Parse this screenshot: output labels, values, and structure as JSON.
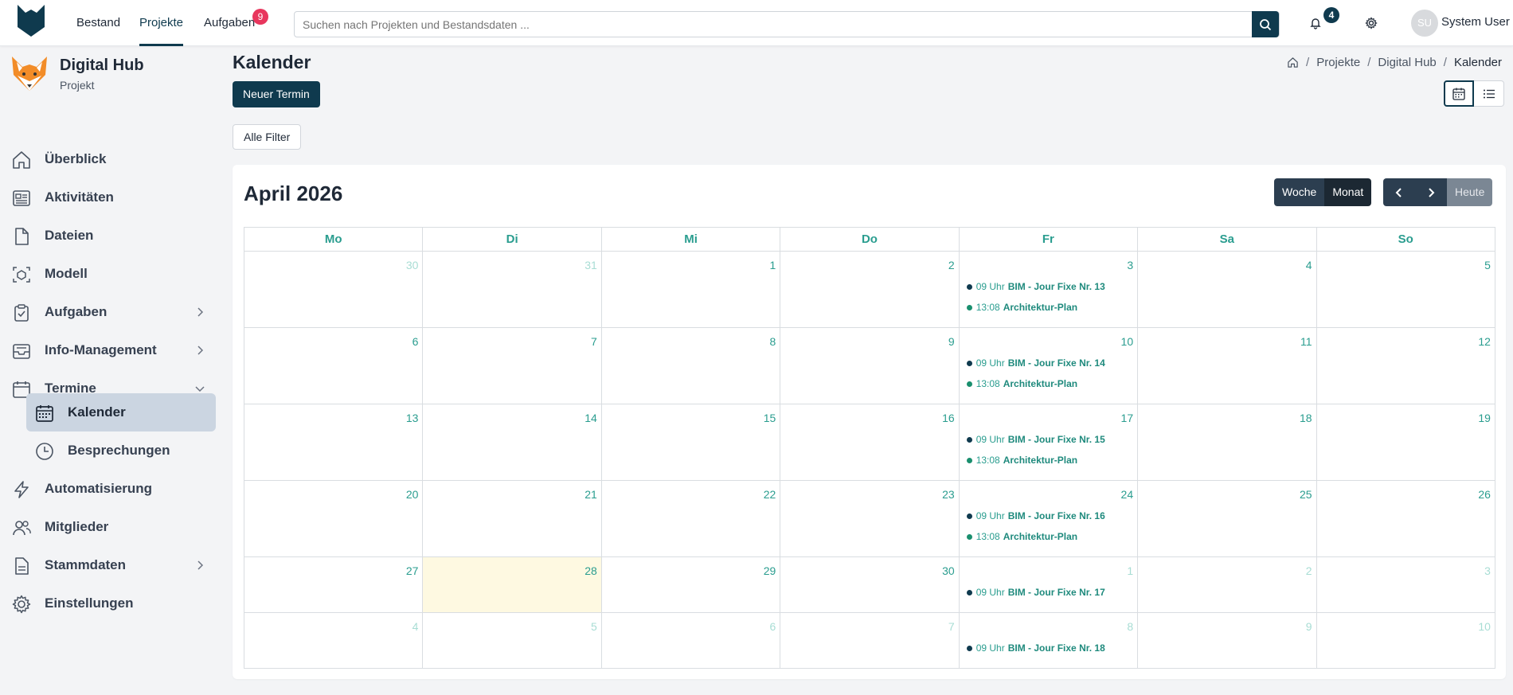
{
  "topnav": {
    "links": [
      "Bestand",
      "Projekte",
      "Aufgaben"
    ],
    "tasks_badge": "9",
    "search_placeholder": "Suchen nach Projekten und Bestandsdaten ...",
    "notifications_badge": "4",
    "user_initials": "SU",
    "user_name": "System User"
  },
  "project": {
    "title": "Digital Hub",
    "subtitle": "Projekt"
  },
  "sidebar": {
    "items": [
      "Überblick",
      "Aktivitäten",
      "Dateien",
      "Modell",
      "Aufgaben",
      "Info-Management",
      "Termine",
      "Automatisierung",
      "Mitglieder",
      "Stammdaten",
      "Einstellungen"
    ],
    "sub_items": [
      "Kalender",
      "Besprechungen"
    ]
  },
  "page": {
    "title": "Kalender",
    "new_button": "Neuer Termin",
    "filter_button": "Alle Filter",
    "breadcrumb": [
      "Projekte",
      "Digital Hub",
      "Kalender"
    ]
  },
  "calendar": {
    "title": "April 2026",
    "view_week": "Woche",
    "view_month": "Monat",
    "today": "Heute",
    "weekdays": [
      "Mo",
      "Di",
      "Mi",
      "Do",
      "Fr",
      "Sa",
      "So"
    ],
    "weeks": [
      {
        "days": [
          "30",
          "31",
          "1",
          "2",
          "3",
          "4",
          "5"
        ],
        "other": [
          0,
          1
        ]
      },
      {
        "days": [
          "6",
          "7",
          "8",
          "9",
          "10",
          "11",
          "12"
        ],
        "other": []
      },
      {
        "days": [
          "13",
          "14",
          "15",
          "16",
          "17",
          "18",
          "19"
        ],
        "other": []
      },
      {
        "days": [
          "20",
          "21",
          "22",
          "23",
          "24",
          "25",
          "26"
        ],
        "other": []
      },
      {
        "days": [
          "27",
          "28",
          "29",
          "30",
          "1",
          "2",
          "3"
        ],
        "other": [
          4,
          5,
          6
        ]
      },
      {
        "days": [
          "4",
          "5",
          "6",
          "7",
          "8",
          "9",
          "10"
        ],
        "other": [
          0,
          1,
          2,
          3,
          4,
          5,
          6
        ]
      }
    ],
    "today_cell": {
      "week": 4,
      "day": 1
    },
    "events": [
      {
        "week": 0,
        "day": 4,
        "time": "09 Uhr",
        "name": "BIM - Jour Fixe Nr. 13",
        "color": "#0f3a4e"
      },
      {
        "week": 0,
        "day": 4,
        "time": "13:08",
        "name": "Architektur-Plan",
        "color": "#1a8f6e"
      },
      {
        "week": 1,
        "day": 4,
        "time": "09 Uhr",
        "name": "BIM - Jour Fixe Nr. 14",
        "color": "#0f3a4e"
      },
      {
        "week": 1,
        "day": 4,
        "time": "13:08",
        "name": "Architektur-Plan",
        "color": "#1a8f6e"
      },
      {
        "week": 2,
        "day": 4,
        "time": "09 Uhr",
        "name": "BIM - Jour Fixe Nr. 15",
        "color": "#0f3a4e"
      },
      {
        "week": 2,
        "day": 4,
        "time": "13:08",
        "name": "Architektur-Plan",
        "color": "#1a8f6e"
      },
      {
        "week": 3,
        "day": 4,
        "time": "09 Uhr",
        "name": "BIM - Jour Fixe Nr. 16",
        "color": "#0f3a4e"
      },
      {
        "week": 3,
        "day": 4,
        "time": "13:08",
        "name": "Architektur-Plan",
        "color": "#1a8f6e"
      },
      {
        "week": 4,
        "day": 4,
        "time": "09 Uhr",
        "name": "BIM - Jour Fixe Nr. 17",
        "color": "#0f3a4e"
      },
      {
        "week": 5,
        "day": 4,
        "time": "09 Uhr",
        "name": "BIM - Jour Fixe Nr. 18",
        "color": "#0f3a4e"
      }
    ]
  },
  "colors": {
    "brand": "#0f3a4e",
    "accent_teal": "#2a9d8f",
    "today_bg": "#fef9e1",
    "badge_red": "#e8365d"
  }
}
